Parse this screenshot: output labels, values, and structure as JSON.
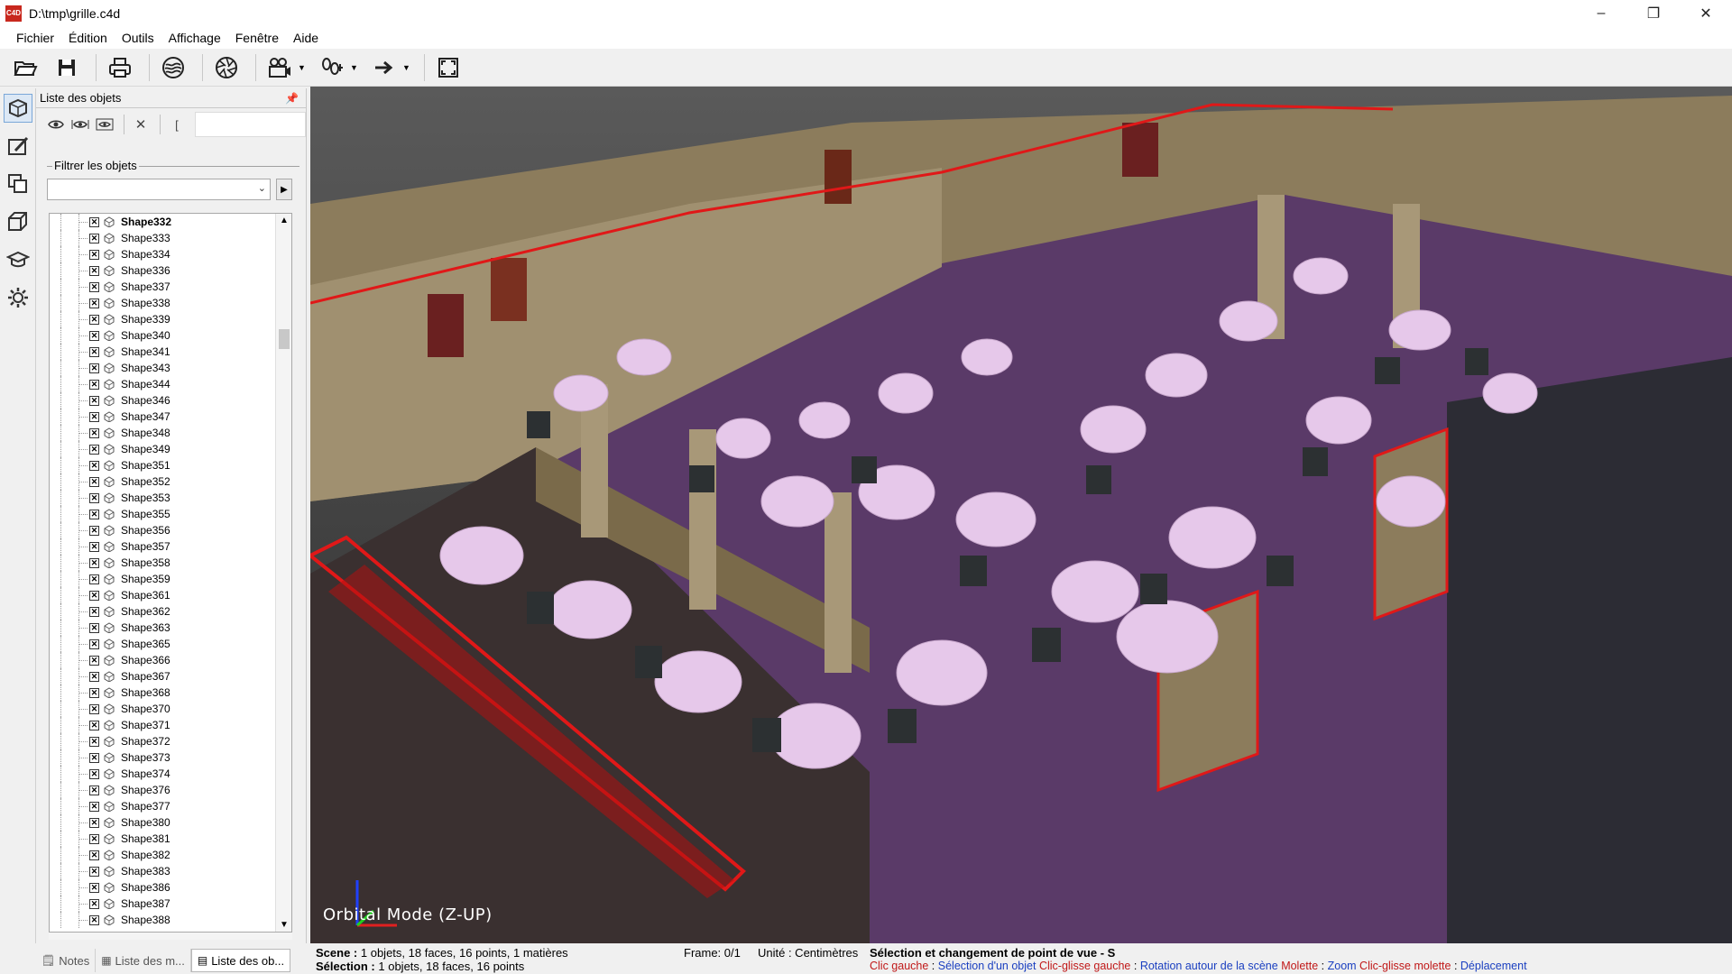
{
  "window": {
    "title": "D:\\tmp\\grille.c4d",
    "app_icon_text": "C4D"
  },
  "menu": [
    "Fichier",
    "Édition",
    "Outils",
    "Affichage",
    "Fenêtre",
    "Aide"
  ],
  "toolbar": {
    "buttons": [
      "open-folder-icon",
      "save-icon",
      "print-icon",
      "texture-icon",
      "aperture-icon",
      "camera-icon",
      "footsteps-icon",
      "arrow-right-icon",
      "fullscreen-icon"
    ]
  },
  "object_panel": {
    "title": "Liste des objets",
    "filter_label": "Filtrer les objets",
    "filter_value": "",
    "objects": [
      "Shape332",
      "Shape333",
      "Shape334",
      "Shape336",
      "Shape337",
      "Shape338",
      "Shape339",
      "Shape340",
      "Shape341",
      "Shape343",
      "Shape344",
      "Shape346",
      "Shape347",
      "Shape348",
      "Shape349",
      "Shape351",
      "Shape352",
      "Shape353",
      "Shape355",
      "Shape356",
      "Shape357",
      "Shape358",
      "Shape359",
      "Shape361",
      "Shape362",
      "Shape363",
      "Shape365",
      "Shape366",
      "Shape367",
      "Shape368",
      "Shape370",
      "Shape371",
      "Shape372",
      "Shape373",
      "Shape374",
      "Shape376",
      "Shape377",
      "Shape380",
      "Shape381",
      "Shape382",
      "Shape383",
      "Shape386",
      "Shape387",
      "Shape388"
    ],
    "selected_object": "Shape332"
  },
  "bottom_tabs": [
    "Notes",
    "Liste des m...",
    "Liste des ob..."
  ],
  "viewport": {
    "mode_label": "Orbital Mode (Z-UP)"
  },
  "status": {
    "scene_label": "Scene :",
    "scene_value": "1 objets,  18 faces,  16 points,  1 matières",
    "selection_label": "Sélection :",
    "selection_value": "1 objets,  18 faces,  16 points",
    "frame": "Frame: 0/1",
    "unit": "Unité : Centimètres",
    "mode_title": "Sélection et changement de point de vue - S",
    "hints": [
      {
        "key": "Clic gauche",
        "action": "Sélection d'un objet"
      },
      {
        "key": "Clic-glisse gauche",
        "action": "Rotation autour de la scène"
      },
      {
        "key": "Molette",
        "action": "Zoom"
      },
      {
        "key": "Clic-glisse molette",
        "action": "Déplacement"
      }
    ]
  },
  "colors": {
    "accent_red": "#d81e1e",
    "floor_purple": "#5a3a68",
    "tablecloth": "#e6c8ea",
    "wall_beige": "#9c8c6c",
    "hint_key": "#c01818",
    "hint_action": "#1a3fc0"
  }
}
